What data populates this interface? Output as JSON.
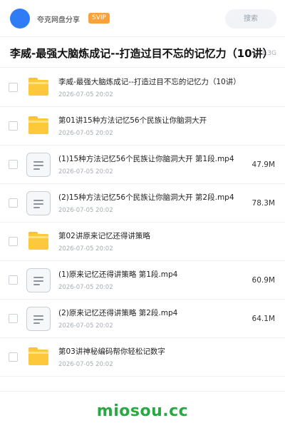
{
  "header": {
    "app_name": "夸克网盘分享",
    "badge": "SVIP",
    "search_label": "搜索"
  },
  "share": {
    "title": "李威-最强大脑炼成记--打造过目不忘的记忆力（10讲）",
    "total_size": "1.3G"
  },
  "items": [
    {
      "type": "folder",
      "name": "李威-最强大脑炼成记--打造过目不忘的记忆力（10讲）",
      "date": "2026-07-05 20:02",
      "size": ""
    },
    {
      "type": "folder",
      "name": "第01讲15种方法记忆56个民族让你脑洞大开",
      "date": "2026-07-05 20:02",
      "size": ""
    },
    {
      "type": "file",
      "name": "(1)15种方法记忆56个民族让你脑洞大开 第1段.mp4",
      "date": "2026-07-05 20:02",
      "size": "47.9M"
    },
    {
      "type": "file",
      "name": "(2)15种方法记忆56个民族让你脑洞大开 第2段.mp4",
      "date": "2026-07-05 20:02",
      "size": "78.3M"
    },
    {
      "type": "folder",
      "name": "第02讲原来记忆还得讲策略",
      "date": "2026-07-05 20:02",
      "size": ""
    },
    {
      "type": "file",
      "name": "(1)原来记忆还得讲策略 第1段.mp4",
      "date": "2026-07-05 20:02",
      "size": "60.9M"
    },
    {
      "type": "file",
      "name": "(2)原来记忆还得讲策略 第2段.mp4",
      "date": "2026-07-05 20:02",
      "size": "64.1M"
    },
    {
      "type": "folder",
      "name": "第03讲神秘编码帮你轻松记数字",
      "date": "2026-07-05 20:02",
      "size": ""
    }
  ],
  "watermark": "miosou.cc",
  "colors": {
    "avatar": "#2f7cf6",
    "svip_badge": "#f7a23b",
    "folder": "#fcc93d",
    "watermark": "#2aa844"
  }
}
